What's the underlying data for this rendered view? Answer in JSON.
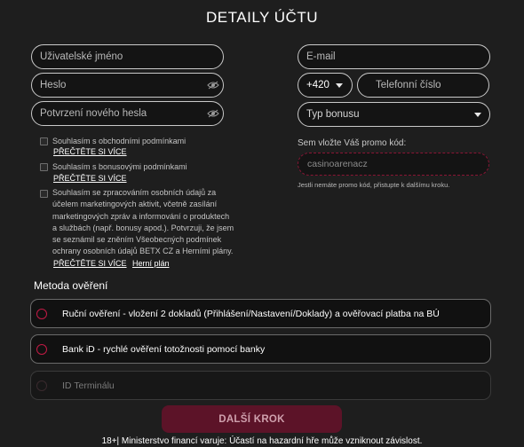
{
  "title": "DETAILY ÚČTU",
  "fields": {
    "username_placeholder": "Uživatelské jméno",
    "password_placeholder": "Heslo",
    "password_confirm_placeholder": "Potvrzení nového hesla",
    "email_placeholder": "E-mail",
    "phone_prefix": "+420",
    "phone_placeholder": "Telefonní číslo",
    "bonus_type_placeholder": "Typ bonusu"
  },
  "consents": {
    "terms": "Souhlasím s obchodními podmínkami",
    "bonus": "Souhlasím s bonusovými podmínkami",
    "marketing_lines": [
      "Souhlasím se zpracováním osobních údajů za",
      "účelem marketingových aktivit, včetně zasílání",
      "marketingových zpráv a informování o produktech",
      "a službách (např. bonusy apod.). Potvrzuji, že jsem",
      "se seznámil se zněním Všeobecných podmínek",
      "ochrany osobních údajů BETX CZ a Herními plány."
    ],
    "read_more": "PŘEČTĚTE SI VÍCE",
    "game_plan": "Herní plán"
  },
  "promo": {
    "label": "Sem vložte Váš promo kód:",
    "value": "casinoarenacz",
    "hint": "Jestli nemáte promo kód, přistupte k dalšímu kroku."
  },
  "verification": {
    "title": "Metoda ověření",
    "options": [
      {
        "label": "Ruční ověření - vložení 2 dokladů (Přihlášení/Nastavení/Doklady) a ověřovací platba na BÚ"
      },
      {
        "label": "Bank iD - rychlé ověření totožnosti pomocí banky"
      },
      {
        "label": "ID Terminálu"
      }
    ]
  },
  "next_button": "DALŠÍ KROK",
  "footer": "18+| Ministerstvo financí varuje: Účastí na hazardní hře může vzniknout závislost.",
  "colors": {
    "background": "#1e1e1e",
    "accent": "#c21a45",
    "button_bg": "#5c1328"
  }
}
